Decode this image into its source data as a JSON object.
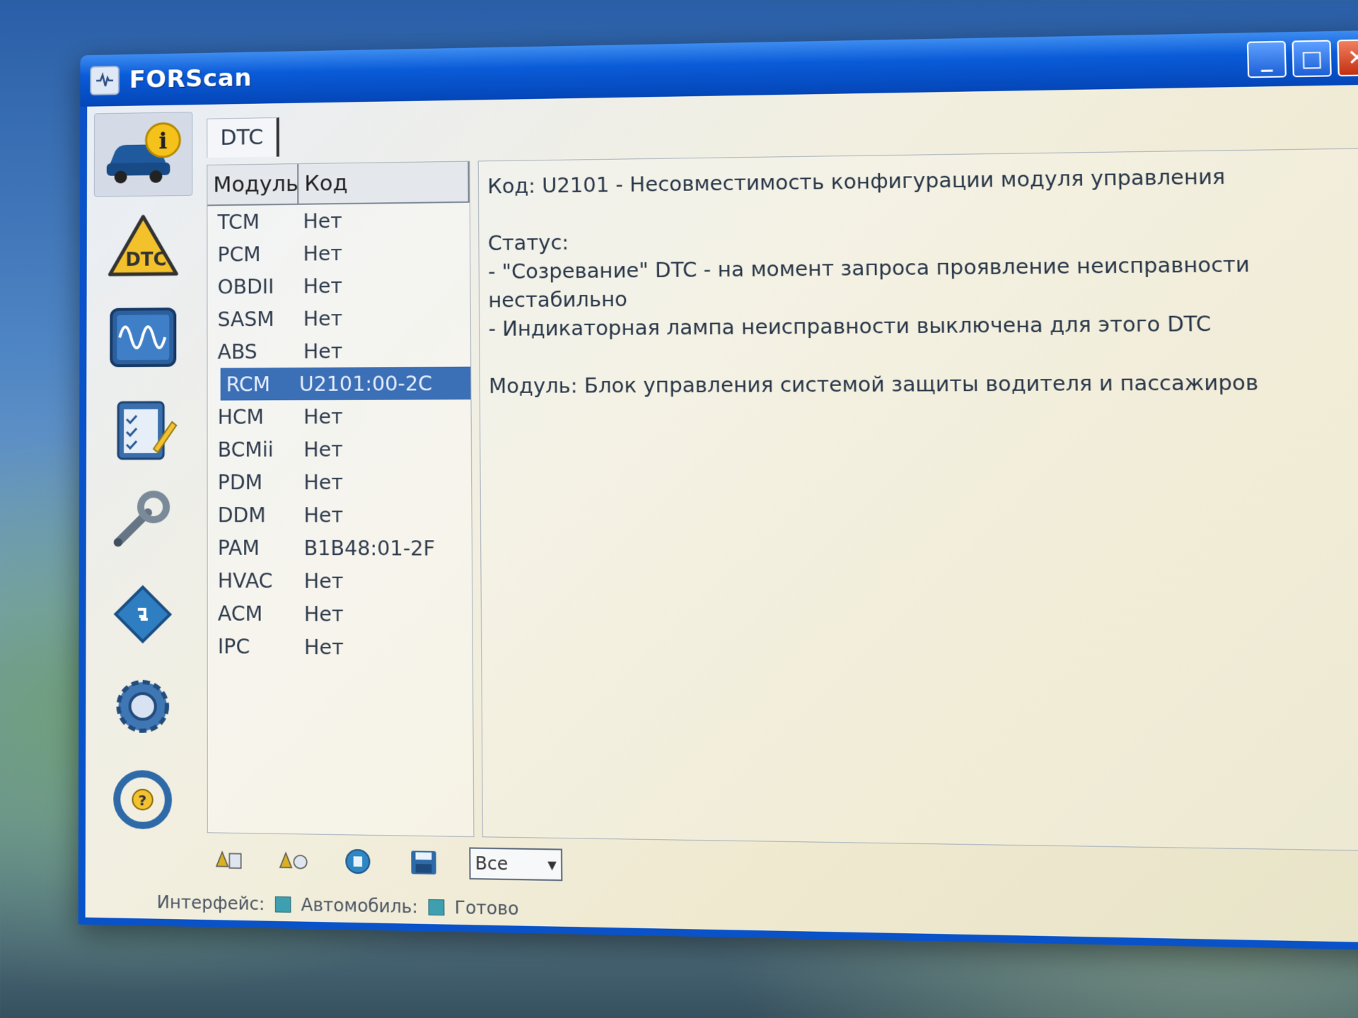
{
  "window": {
    "title": "FORScan",
    "controls": {
      "minimize": "_",
      "maximize": "□",
      "close": "✕"
    }
  },
  "toolbar": {
    "items": [
      {
        "name": "vehicle-info-icon"
      },
      {
        "name": "dtc-icon",
        "label": "DTC"
      },
      {
        "name": "oscilloscope-icon"
      },
      {
        "name": "checklist-icon"
      },
      {
        "name": "wrench-icon"
      },
      {
        "name": "chip-icon"
      },
      {
        "name": "gear-icon"
      },
      {
        "name": "help-steering-wheel-icon"
      }
    ]
  },
  "tabs": [
    {
      "label": "DTC"
    }
  ],
  "table": {
    "headers": {
      "module": "Модуль",
      "code": "Код"
    },
    "rows": [
      {
        "module": "TCM",
        "code": "Нет"
      },
      {
        "module": "PCM",
        "code": "Нет"
      },
      {
        "module": "OBDII",
        "code": "Нет"
      },
      {
        "module": "SASM",
        "code": "Нет"
      },
      {
        "module": "ABS",
        "code": "Нет"
      },
      {
        "module": "RCM",
        "code": "U2101:00-2C"
      },
      {
        "module": "HCM",
        "code": "Нет"
      },
      {
        "module": "BCMii",
        "code": "Нет"
      },
      {
        "module": "PDM",
        "code": "Нет"
      },
      {
        "module": "DDM",
        "code": "Нет"
      },
      {
        "module": "PAM",
        "code": "B1B48:01-2F"
      },
      {
        "module": "HVAC",
        "code": "Нет"
      },
      {
        "module": "ACM",
        "code": "Нет"
      },
      {
        "module": "IPC",
        "code": "Нет"
      }
    ]
  },
  "details": {
    "code_line": "Код: U2101 - Несовместимость конфигурации модуля управления",
    "status_label": "Статус:",
    "status_line1": " - \"Созревание\" DTC - на момент запроса проявление неисправности нестабильно",
    "status_line2": " - Индикаторная лампа неисправности выключена для этого DTC",
    "module_line": "Модуль: Блок управления системой защиты водителя и пассажиров"
  },
  "bottom": {
    "filter_value": "Все",
    "filter_arrow": "▾"
  },
  "status": {
    "interface_label": "Интерфейс:",
    "vehicle_label": "Автомобиль:",
    "ready_label": "Готово",
    "indicator_color": "#3d9fb0"
  }
}
